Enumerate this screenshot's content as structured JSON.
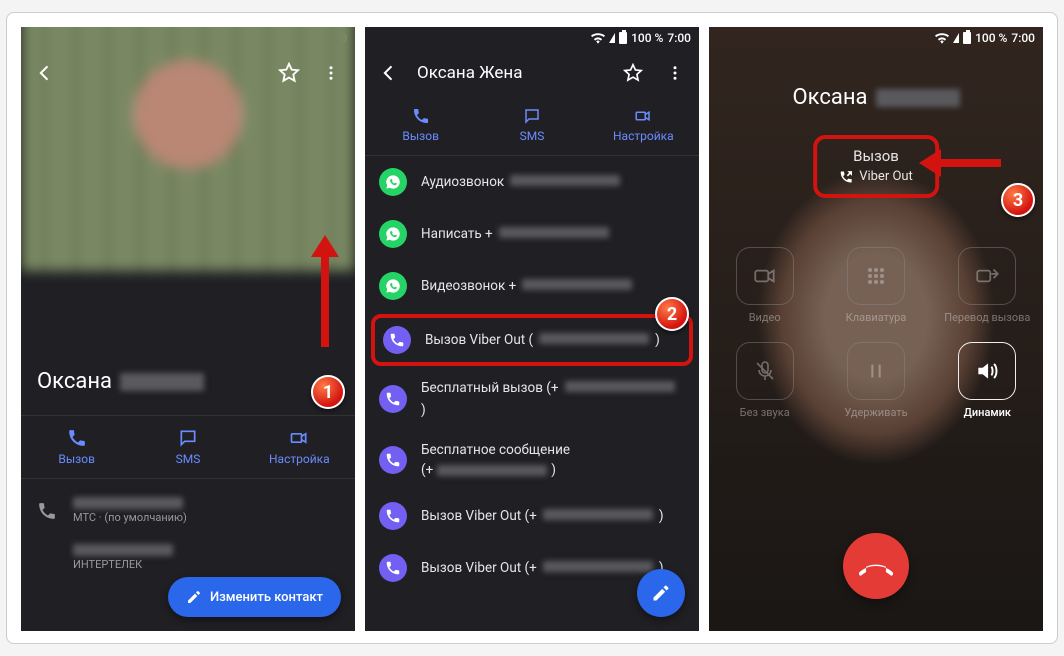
{
  "status": {
    "battery": "100 %",
    "time": "7:00"
  },
  "panel1": {
    "contact_name": "Оксана",
    "actions": {
      "call": "Вызов",
      "sms": "SMS",
      "video": "Настройка"
    },
    "carrier1": "МТС · (по умолчанию)",
    "carrier2": "ИНТЕРТЕЛЕК",
    "edit_btn": "Изменить контакт"
  },
  "panel2": {
    "title": "Оксана Жена",
    "actions": {
      "call": "Вызов",
      "sms": "SMS",
      "video": "Настройка"
    },
    "rows": [
      {
        "icon": "wa",
        "label": "Аудиозвонок"
      },
      {
        "icon": "wa",
        "label": "Написать +"
      },
      {
        "icon": "wa",
        "label": "Видеозвонок +"
      },
      {
        "icon": "vb",
        "label": "Вызов Viber Out (",
        "tail": ")"
      },
      {
        "icon": "vb",
        "label": "Бесплатный вызов (+",
        "tail": ")"
      },
      {
        "icon": "vb",
        "label": "Бесплатное сообщение",
        "secondline": true,
        "prefix": "(+",
        "tail": ")"
      },
      {
        "icon": "vb",
        "label": "Вызов Viber Out (+",
        "tail": ")"
      },
      {
        "icon": "vb",
        "label": "Вызов Viber Out (+",
        "tail": ")"
      }
    ]
  },
  "panel3": {
    "name": "Оксана",
    "call_status": "Вызов",
    "call_method": "Viber Out",
    "buttons": {
      "video": "Видео",
      "keypad": "Клавиатура",
      "transfer": "Перевод вызова",
      "mute": "Без звука",
      "hold": "Удерживать",
      "speaker": "Динамик"
    }
  },
  "badges": {
    "b1": "1",
    "b2": "2",
    "b3": "3"
  }
}
